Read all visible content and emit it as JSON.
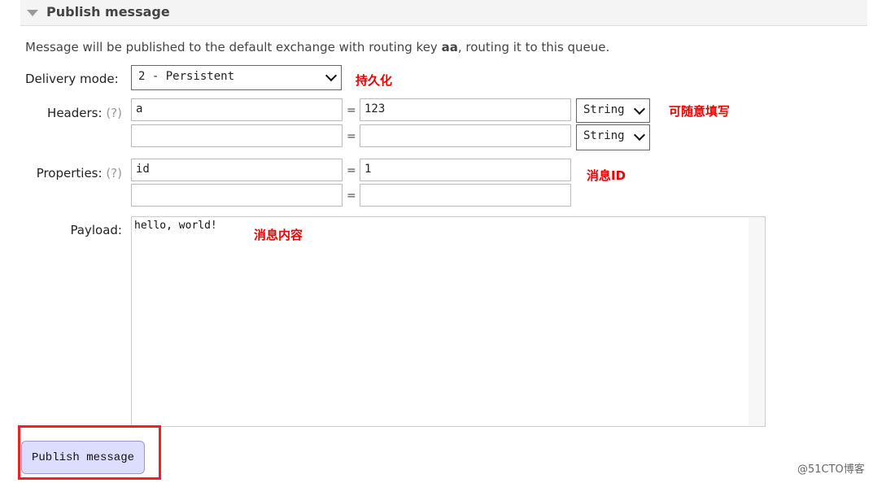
{
  "section": {
    "title": "Publish message",
    "icon": "triangle-down-icon"
  },
  "description": {
    "before": "Message will be published to the default exchange with routing key ",
    "key": "aa",
    "after": ", routing it to this queue."
  },
  "delivery": {
    "label": "Delivery mode:",
    "value": "2 - Persistent",
    "note": "持久化"
  },
  "headers": {
    "label": "Headers:",
    "help": "(?)",
    "rows": [
      {
        "key": "a",
        "value": "123",
        "type": "String"
      },
      {
        "key": "",
        "value": "",
        "type": "String"
      }
    ],
    "note": "可随意填写"
  },
  "properties": {
    "label": "Properties:",
    "help": "(?)",
    "rows": [
      {
        "key": "id",
        "value": "1"
      },
      {
        "key": "",
        "value": ""
      }
    ],
    "note": "消息ID"
  },
  "payload": {
    "label": "Payload:",
    "value": "hello, world!",
    "note": "消息内容"
  },
  "publish_button": "Publish message",
  "watermark": "@51CTO博客",
  "colors": {
    "annotation": "#e00000",
    "button_bg": "#ddddff"
  }
}
